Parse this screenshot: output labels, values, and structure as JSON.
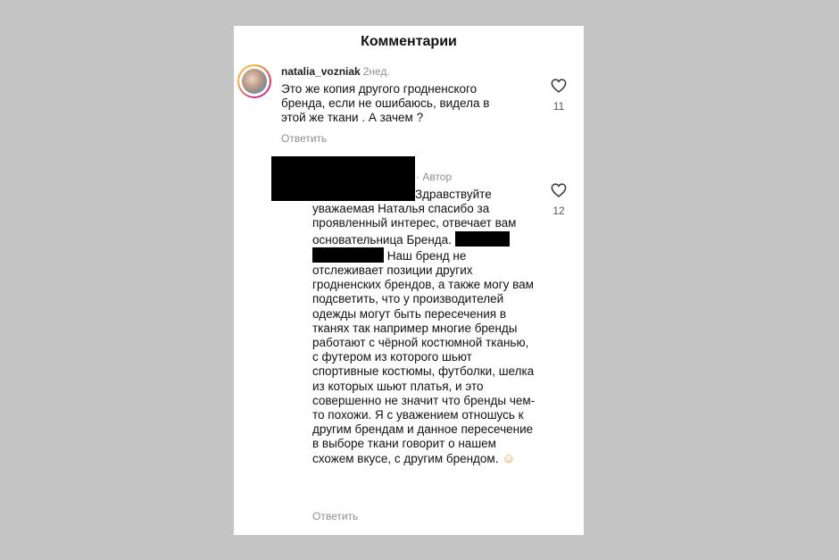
{
  "header": {
    "title": "Комментарии"
  },
  "comment1": {
    "username": "natalia_vozniak",
    "time": "2нед.",
    "text": "Это же копия другого гродненского\nбренда, если не ошибаюсь, видела в\nэтой же ткани . А зачем ?",
    "likes": "11",
    "reply_label": "Ответить"
  },
  "comment2": {
    "author_label": "· Автор",
    "text_part1": "Здравствуйте уважаемая Наталья спасибо за проявленный интерес, отвечает вам основательница Бренда.",
    "text_part2": "Наш бренд не отслеживает позиции других гродненских брендов, а также могу вам подсветить,  что у производителей  одежды могут быть пересечения в тканях так например многие бренды работают с чёрной костюмной тканью, с футером из которого шьют спортивные костюмы, футболки, шелка из которых шьют платья, и это совершенно не значит что бренды чем-то похожи. Я с уважением отношусь к другим брендам и данное  пересечение в выборе ткани говорит о нашем схожем  вкусе, с другим брендом.",
    "emoji": "☺",
    "likes": "12",
    "reply_label": "Ответить"
  },
  "icons": {
    "like": "heart-outline-icon",
    "avatar": "avatar-photo"
  }
}
